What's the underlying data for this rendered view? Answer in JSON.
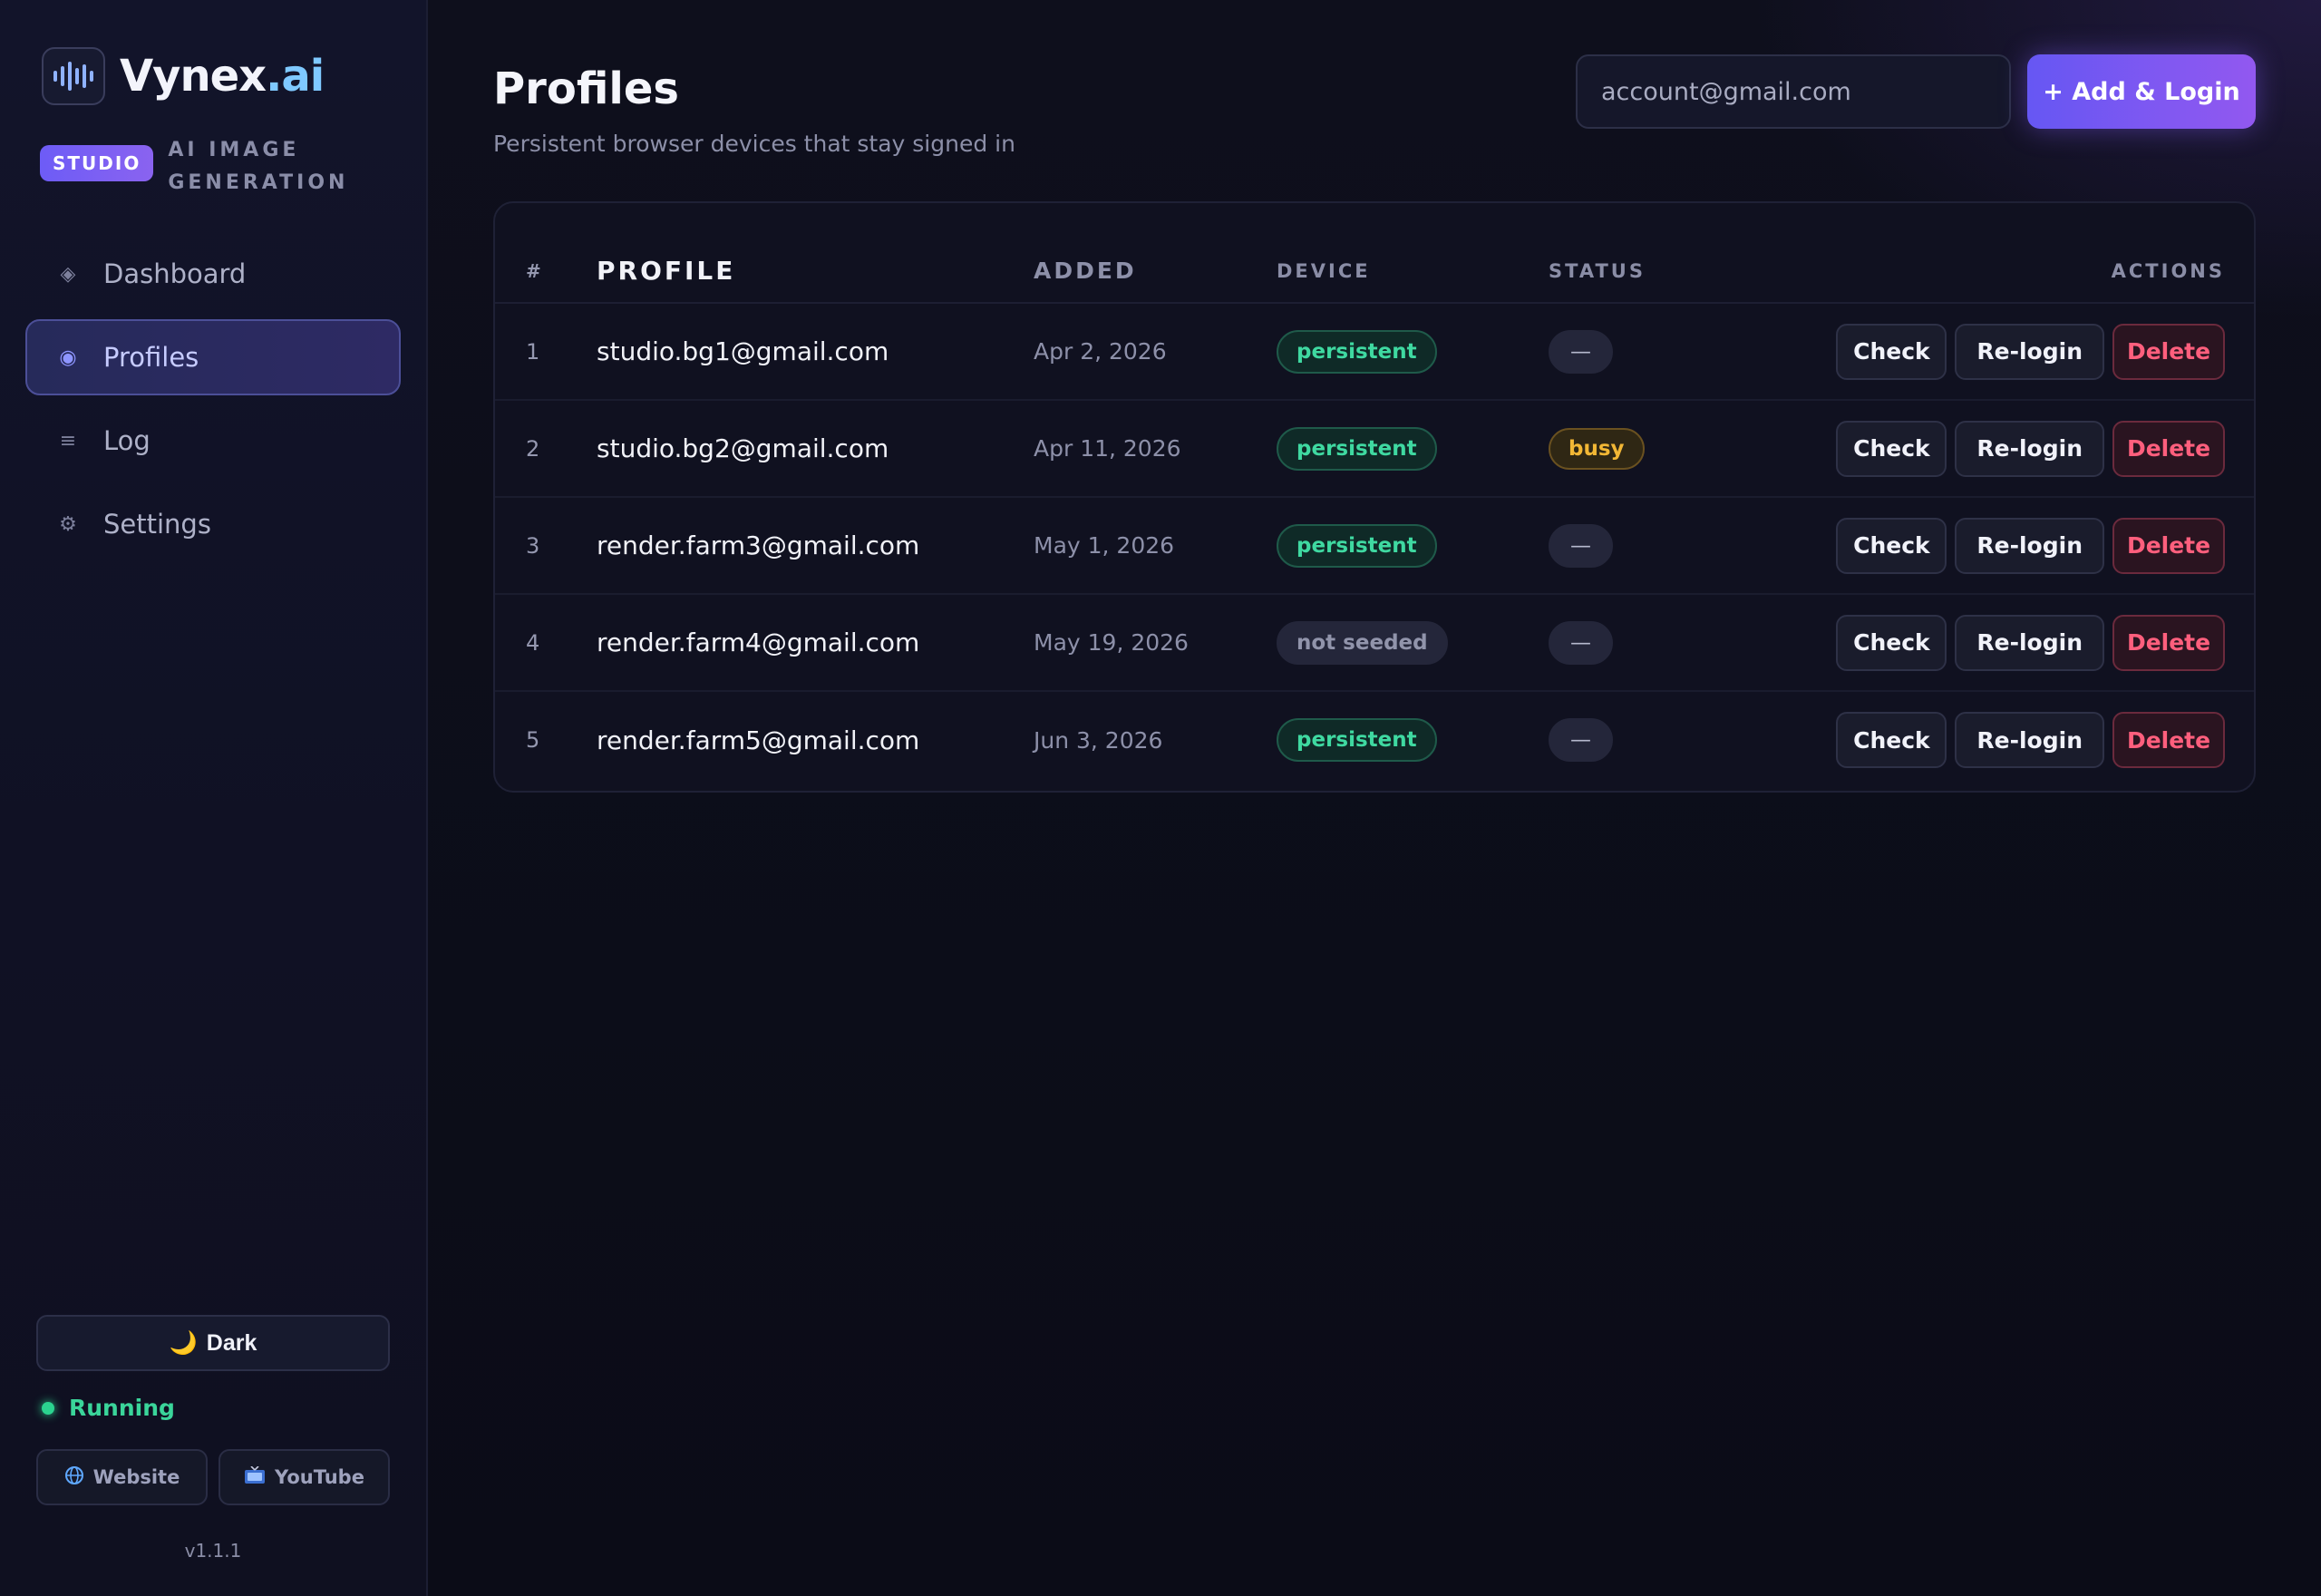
{
  "brand": {
    "name": "Vynex",
    "suffix": ".ai",
    "badge": "STUDIO",
    "subtitle": "AI IMAGE GENERATION"
  },
  "nav": {
    "items": [
      {
        "id": "dashboard",
        "label": "Dashboard",
        "icon": "diamond-icon",
        "glyph": "◈",
        "active": false
      },
      {
        "id": "profiles",
        "label": "Profiles",
        "icon": "target-icon",
        "glyph": "◉",
        "active": true
      },
      {
        "id": "log",
        "label": "Log",
        "icon": "list-icon",
        "glyph": "≡",
        "active": false
      },
      {
        "id": "settings",
        "label": "Settings",
        "icon": "gear-icon",
        "glyph": "⚙",
        "active": false
      }
    ]
  },
  "sidebar_bottom": {
    "theme_label": "Dark",
    "theme_glyph": "🌙",
    "status": "Running",
    "website_label": "Website",
    "youtube_label": "YouTube",
    "version": "v1.1.1"
  },
  "header": {
    "title": "Profiles",
    "subtitle": "Persistent browser devices that stay signed in",
    "email_placeholder": "account@gmail.com",
    "add_button": "+ Add & Login"
  },
  "table": {
    "columns": {
      "num": "#",
      "profile": "PROFILE",
      "added": "ADDED",
      "device": "DEVICE",
      "status": "STATUS",
      "actions": "ACTIONS"
    },
    "actions": {
      "check": "Check",
      "relogin": "Re-login",
      "delete": "Delete"
    },
    "rows": [
      {
        "num": "1",
        "profile": "studio.bg1@gmail.com",
        "added": "Apr 2, 2026",
        "device": "persistent",
        "status": "—"
      },
      {
        "num": "2",
        "profile": "studio.bg2@gmail.com",
        "added": "Apr 11, 2026",
        "device": "persistent",
        "status": "busy"
      },
      {
        "num": "3",
        "profile": "render.farm3@gmail.com",
        "added": "May 1, 2026",
        "device": "persistent",
        "status": "—"
      },
      {
        "num": "4",
        "profile": "render.farm4@gmail.com",
        "added": "May 19, 2026",
        "device": "not seeded",
        "status": "—"
      },
      {
        "num": "5",
        "profile": "render.farm5@gmail.com",
        "added": "Jun 3, 2026",
        "device": "persistent",
        "status": "—"
      }
    ]
  },
  "colors": {
    "accent": "#6d5cf6",
    "success": "#3fd9a1",
    "warning": "#f2b735",
    "danger": "#ff5f7d"
  }
}
